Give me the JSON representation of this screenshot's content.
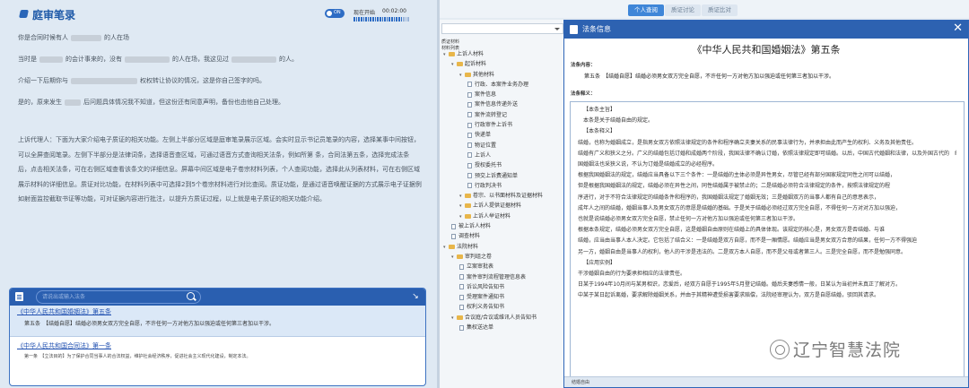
{
  "left": {
    "title": "庭审笔录",
    "toggle_label": "ON",
    "record_label": "现在开始",
    "record_time": "00:02:00",
    "record_progress": 0.87
  },
  "transcript": {
    "lines": [
      {
        "a": "你是合同时候有人",
        "b": "的人在场"
      },
      {
        "a": "当时是",
        "b": "的会计事来的，没有",
        "c": "的人在场，我这见过",
        "d": "的人。"
      },
      {
        "a": "介绍一下后期你与",
        "b": "权权转让协议的情况，这是你自己签字的吗。"
      },
      {
        "a": "是的，原来发生",
        "b": "后问题具体情况我不知道，但这份还有同意声明，备份也由他自己处理。"
      }
    ],
    "paragraph": "上诉代理人：下面为大家介绍电子质证的相关功能。左侧上半部分区域是庭审笔录展示区域。会实时显示书记员笔录的内容，选择某事中间按钮，可以全屏查阅笔录。左侧下半部分是法律词条，选择语音查区域，可通过语音方式查询相关法条，例如所第 条，合同法第五条，选择完成法条后，点击相关法条，可在右侧区域查看该条文的详细信息。屏幕中间区域是电子卷宗材料列表，个人查阅功能，选择此从列表材料，可在右侧区域展示材料的详细信息。质证对比功能，在材料列表中可选择2到5个卷宗材料进行对比查阅。质证功能，是通过语音唤醒证据的方式展示电子证据例如射面监控截取书证等功能，可对证据内容进行批注，以提升方质证过程，以上就是电子质证的相关功能介绍。"
  },
  "search": {
    "placeholder": "请说出或输入法条",
    "result1_title": "《中华人民共和国婚姻法》第五条",
    "result1_text": "第五条　【结婚自愿】结婚必须男女双方完全自愿，不许任何一方对他方加以强迫或任何第三者加以干涉。",
    "result2_title": "《中华人民共和国合同法》第一条",
    "result2_text": "第一条　【立法目的】为了保护合同当事人的合法权益，维护社会经济秩序，促进社会主义现代化建设，制定本法。"
  },
  "tabs": [
    "个人查阅",
    "质证讨论",
    "质证比对"
  ],
  "active_tab": 0,
  "tree": {
    "caption": "质证材料",
    "section": "材料列表",
    "nodes": [
      {
        "level": 0,
        "kind": "folder",
        "open": true,
        "label": "上诉人材料"
      },
      {
        "level": 1,
        "kind": "folder",
        "open": true,
        "label": "起诉材料"
      },
      {
        "level": 2,
        "kind": "folder",
        "open": true,
        "label": "其他材料"
      },
      {
        "level": 3,
        "kind": "doc",
        "label": "行政、本案件业务办理"
      },
      {
        "level": 3,
        "kind": "doc",
        "label": "案件信息"
      },
      {
        "level": 3,
        "kind": "doc",
        "label": "案件信息传递外送"
      },
      {
        "level": 3,
        "kind": "doc",
        "label": "案件流转登记"
      },
      {
        "level": 3,
        "kind": "doc",
        "label": "行政审件上诉书"
      },
      {
        "level": 3,
        "kind": "doc",
        "label": "快递单"
      },
      {
        "level": 3,
        "kind": "doc",
        "label": "物证位置"
      },
      {
        "level": 3,
        "kind": "doc",
        "label": "上诉人"
      },
      {
        "level": 3,
        "kind": "doc",
        "label": "授权委托书"
      },
      {
        "level": 3,
        "kind": "doc",
        "label": "预交上诉费通知单"
      },
      {
        "level": 3,
        "kind": "doc",
        "label": "行政判决书"
      },
      {
        "level": 2,
        "kind": "folder",
        "open": true,
        "label": "卷宗、以书面材料及证据材料"
      },
      {
        "level": 2,
        "kind": "folder",
        "open": true,
        "label": "上诉人提供证据材料"
      },
      {
        "level": 2,
        "kind": "folder",
        "open": true,
        "label": "上诉人举证材料"
      },
      {
        "level": 1,
        "kind": "doc",
        "label": "被上诉人材料"
      },
      {
        "level": 1,
        "kind": "doc",
        "label": "调查材料"
      },
      {
        "level": 0,
        "kind": "folder",
        "open": true,
        "label": "法院材料"
      },
      {
        "level": 1,
        "kind": "folder",
        "open": true,
        "label": "审判组之卷"
      },
      {
        "level": 2,
        "kind": "doc",
        "label": "立案审批表"
      },
      {
        "level": 2,
        "kind": "doc",
        "label": "案件审判流程管理信息表"
      },
      {
        "level": 2,
        "kind": "doc",
        "label": "诉讼风险告知书"
      },
      {
        "level": 2,
        "kind": "doc",
        "label": "受理案件通知书"
      },
      {
        "level": 2,
        "kind": "doc",
        "label": "权利义务告知书"
      },
      {
        "level": 1,
        "kind": "folder",
        "open": true,
        "label": "合议庭/合议或维讯人员告知书"
      },
      {
        "level": 2,
        "kind": "doc",
        "label": "集权送达单"
      }
    ]
  },
  "law": {
    "window_title": "法条信息",
    "title": "《中华人民共和国婚姻法》第五条",
    "label_content": "法条内容：",
    "article": "第五条　【结婚自愿】结婚必须男女双方完全自愿，不许任何一方对他方加以强迫或任何第三者加以干涉。",
    "label_interp": "法条释义：",
    "interp": [
      "【本条主旨】",
      "本条是关于结婚自由的规定。",
      "【本条释义】",
      "结婚，也称为婚姻成立，是指男女双方依照法律规定的条件和程序确立夫妻关系的民事法律行为，并承担由此而产生的权利、义务及其他责任。",
      "结婚有广义和狭义之分。广义的结婚包括订婚和成婚两个阶段，我国法律不确认订婚，依照法律规定即可结婚。以后，中国古代婚姻和法律，以及外国古代的　结婚都是广义实现。狭义的结婚，仅指夫妻关系的建立，不包括婚约的缔结。而在，现代各国婚姻立法，多采狭义说。我",
      "国婚姻法也采狭义说，不认为订婚是结婚成立的必经程序。",
      "根据我国婚姻法的规定，结婚应当具备以下三个条件：一是结婚的主体必须是异性男女，尽管已经有部分国家规定同性之间可以结婚，",
      "但是根据我国婚姻法的规定，结婚必须在异性之间，同性结婚属于被禁止的；二是结婚必须符合法律规定的条件，按照法律规定的程",
      "序进行，对于不符合法律规定的结婚条件和程序的，我国婚姻法规定了婚姻无效；三是婚姻双方的当事人都有自己的意思表示，",
      "成年人之间的结婚，婚姻当事人及男女双方的意愿是结婚的基础。于是关于结婚必须经过双方完全自愿，不得任何一方对对方加以强迫，",
      "也就是说结婚必须男女双方完全自愿，禁止任何一方对他方加以强迫或任何第三者加以干涉。",
      "根据本条规定，结婚必须男女双方完全自愿，这是婚姻自由原则在结婚上的具体体现。该规定的核心是，男女双方是否结婚、与谁",
      "结婚，应当由当事人本人决定。它包括了结合义：一是结婚是双方自愿，而不是一厢情愿。结婚应当是男女双方合意的结果，任何一方不得强迫",
      "另一方，婚姻自由是当事人的权利，他人的干涉是违法的。二是双方本人自愿，而不是父母或者第三人。三是完全自愿，而不是勉强同意。",
      "【应用实例】",
      "干涉婚姻自由的行为要承担相应的法律责任。",
      "日某于1994年10月间与某男相识，恋爱后，经双方自愿于1995年5月登记结婚。婚后夫妻感情一般，日某认为当初并未真正了解对方。",
      "中某于某日起诉离婚，要求解除婚姻关系，并由于其精神遭受损害要求赔偿，法院经审理认为，双方是自愿结婚，驳回其请求。"
    ],
    "footer": "结婚自由"
  },
  "watermark": "辽宁智慧法院"
}
